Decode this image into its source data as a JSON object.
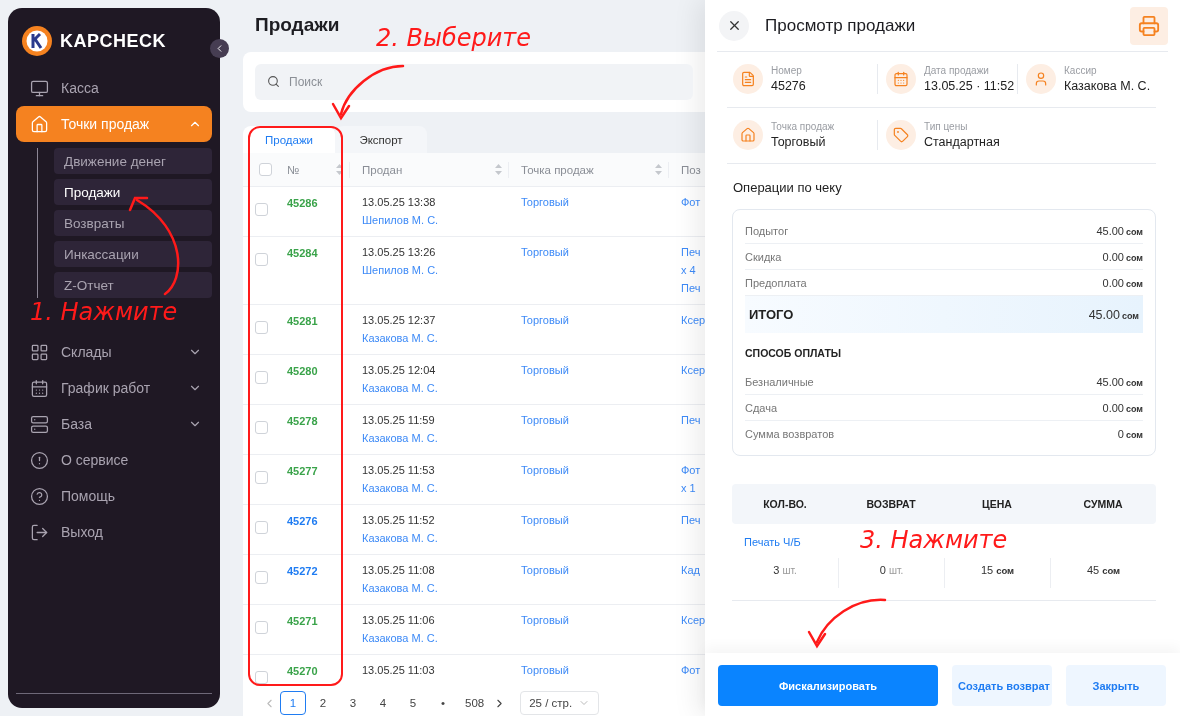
{
  "sidebar": {
    "brand": "KAPCHECK",
    "items": [
      {
        "label": "Касса",
        "selected": false
      },
      {
        "label": "Точки продаж",
        "selected": true,
        "expanded": true,
        "children": [
          {
            "label": "Движение денег",
            "selected": false
          },
          {
            "label": "Продажи",
            "selected": true
          },
          {
            "label": "Возвраты",
            "selected": false
          },
          {
            "label": "Инкассации",
            "selected": false
          },
          {
            "label": "Z-Отчет",
            "selected": false
          }
        ]
      },
      {
        "label": "Склады",
        "selected": false,
        "expanded": false
      },
      {
        "label": "График работ",
        "selected": false,
        "expanded": false
      },
      {
        "label": "База",
        "selected": false,
        "expanded": false
      },
      {
        "label": "О сервисе",
        "selected": false
      },
      {
        "label": "Помощь",
        "selected": false
      },
      {
        "label": "Выход",
        "selected": false
      }
    ]
  },
  "page": {
    "title": "Продажи",
    "search": {
      "placeholder": "Поиск"
    },
    "tabs": [
      {
        "label": "Продажи",
        "selected": true
      },
      {
        "label": "Экспорт",
        "selected": false
      }
    ],
    "table": {
      "select_all_checked": false,
      "columns": [
        "№",
        "Продан",
        "Точка продаж",
        "Поз"
      ],
      "rows": [
        {
          "checked": false,
          "number": "45286",
          "color": "#3aa34a",
          "sold_at": "13.05.25 13:38",
          "cashier": "Шепилов М. С.",
          "point": "Торговый",
          "column_4": [
            "Фот"
          ]
        },
        {
          "checked": false,
          "number": "45284",
          "color": "#3aa34a",
          "sold_at": "13.05.25 13:26",
          "cashier": "Шепилов М. С.",
          "point": "Торговый",
          "column_4": [
            "Печ",
            "x 4",
            "Печ"
          ]
        },
        {
          "checked": false,
          "number": "45281",
          "color": "#3aa34a",
          "sold_at": "13.05.25 12:37",
          "cashier": "Казакова М. С.",
          "point": "Торговый",
          "column_4": [
            "Ксер"
          ]
        },
        {
          "checked": false,
          "number": "45280",
          "color": "#3aa34a",
          "sold_at": "13.05.25 12:04",
          "cashier": "Казакова М. С.",
          "point": "Торговый",
          "column_4": [
            "Ксер"
          ]
        },
        {
          "checked": false,
          "number": "45278",
          "color": "#3aa34a",
          "sold_at": "13.05.25 11:59",
          "cashier": "Казакова М. С.",
          "point": "Торговый",
          "column_4": [
            "Печ"
          ]
        },
        {
          "checked": false,
          "number": "45277",
          "color": "#3aa34a",
          "sold_at": "13.05.25 11:53",
          "cashier": "Казакова М. С.",
          "point": "Торговый",
          "column_4": [
            "Фот",
            "x 1"
          ]
        },
        {
          "checked": false,
          "number": "45276",
          "color": "#1f7cf2",
          "sold_at": "13.05.25 11:52",
          "cashier": "Казакова М. С.",
          "point": "Торговый",
          "column_4": [
            "Печ"
          ]
        },
        {
          "checked": false,
          "number": "45272",
          "color": "#1f7cf2",
          "sold_at": "13.05.25 11:08",
          "cashier": "Казакова М. С.",
          "point": "Торговый",
          "column_4": [
            "Кад"
          ]
        },
        {
          "checked": false,
          "number": "45271",
          "color": "#3aa34a",
          "sold_at": "13.05.25 11:06",
          "cashier": "Казакова М. С.",
          "point": "Торговый",
          "column_4": [
            "Ксер"
          ]
        },
        {
          "checked": false,
          "number": "45270",
          "color": "#3aa34a",
          "sold_at": "13.05.25 11:03",
          "cashier": "",
          "point": "Торговый",
          "column_4": [
            "Фот"
          ]
        }
      ]
    },
    "pagination": {
      "pages": [
        {
          "label": "1",
          "selected": true
        },
        {
          "label": "2",
          "selected": false
        },
        {
          "label": "3",
          "selected": false
        },
        {
          "label": "4",
          "selected": false
        },
        {
          "label": "5",
          "selected": false
        },
        {
          "label": "•",
          "selected": false
        },
        {
          "label": "508",
          "selected": false
        }
      ],
      "page_size": "25 / стр."
    }
  },
  "drawer": {
    "title": "Просмотр продажи",
    "info_rows": [
      [
        {
          "label": "Номер",
          "value": "45276"
        },
        {
          "label": "Дата продажи",
          "value": "13.05.25 · 11:52"
        },
        {
          "label": "Кассир",
          "value": "Казакова М. С."
        }
      ],
      [
        {
          "label": "Точка продаж",
          "value": "Торговый"
        },
        {
          "label": "Тип цены",
          "value": "Стандартная"
        }
      ]
    ],
    "operations_title": "Операции по чеку",
    "summary": [
      {
        "label": "Подытог",
        "amount": "45.00",
        "currency": "сом"
      },
      {
        "label": "Скидка",
        "amount": "0.00",
        "currency": "сом"
      },
      {
        "label": "Предоплата",
        "amount": "0.00",
        "currency": "сом"
      }
    ],
    "total": {
      "label": "ИТОГО",
      "amount": "45.00",
      "currency": "сом"
    },
    "payment_title": "СПОСОБ ОПЛАТЫ",
    "payments": [
      {
        "label": "Безналичные",
        "amount": "45.00",
        "currency": "сом"
      },
      {
        "label": "Сдача",
        "amount": "0.00",
        "currency": "сом"
      },
      {
        "label": "Сумма возвратов",
        "amount": "0",
        "currency": "сом"
      }
    ],
    "items_columns": [
      "КОЛ-ВО.",
      "ВОЗВРАТ",
      "ЦЕНА",
      "СУММА"
    ],
    "items": [
      {
        "name": "Печать Ч/Б",
        "cells": [
          {
            "value": "3",
            "unit": "шт.",
            "kind": "count"
          },
          {
            "value": "0",
            "unit": "шт.",
            "kind": "count"
          },
          {
            "value": "15",
            "unit": "сом",
            "kind": "money"
          },
          {
            "value": "45",
            "unit": "сом",
            "kind": "money"
          }
        ]
      }
    ],
    "buttons": [
      {
        "label": "Фискализировать",
        "kind": "primary"
      },
      {
        "label": "Создать возврат",
        "kind": "secondary"
      },
      {
        "label": "Закрыть",
        "kind": "secondary"
      }
    ]
  },
  "annotations": [
    {
      "text": "1. Нажмите"
    },
    {
      "text": "2. Выберите"
    },
    {
      "text": "3. Нажмите"
    }
  ]
}
